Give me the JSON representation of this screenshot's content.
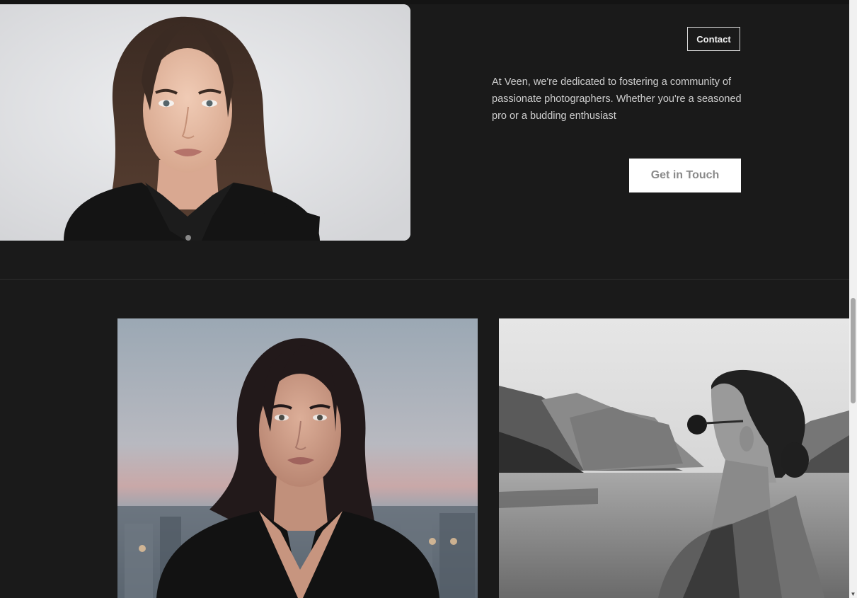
{
  "header": {
    "contact_label": "Contact"
  },
  "intro": {
    "text": "At Veen, we're dedicated to fostering a community of passionate photographers. Whether you're a seasoned pro or a budding enthusiast",
    "cta_label": "Get in Touch"
  },
  "scrollbar": {
    "down_arrow": "▼"
  },
  "colors": {
    "background": "#1a1a1a",
    "text": "#cfcfcf",
    "cta_background": "#ffffff",
    "cta_text": "#8a8a8a"
  }
}
